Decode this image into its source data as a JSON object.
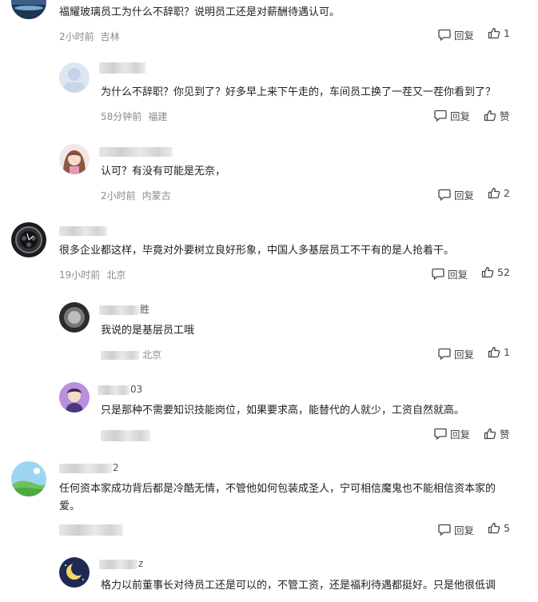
{
  "comments": [
    {
      "text": "福耀玻璃员工为什么不辞职？说明员工还是对薪酬待遇认可。",
      "time": "2小时前",
      "location": "吉林",
      "reply_label": "回复",
      "like_label": "1"
    },
    {
      "username": "",
      "text": "为什么不辞职？你见到了？好多早上来下午走的，车间员工换了一茬又一茬你看到了？",
      "time": "58分钟前",
      "location": "福建",
      "reply_label": "回复",
      "like_label": "赞"
    },
    {
      "username": "",
      "text": "认可？有没有可能是无奈，",
      "time": "2小时前",
      "location": "内蒙古",
      "reply_label": "回复",
      "like_label": "2"
    },
    {
      "username": "",
      "text": "很多企业都这样，毕竟对外要树立良好形象，中国人多基层员工不干有的是人抢着干。",
      "time": "19小时前",
      "location": "北京",
      "reply_label": "回复",
      "like_label": "52"
    },
    {
      "username_suffix": "胜",
      "text": "我说的是基层员工哦",
      "time": "",
      "location": "北京",
      "reply_label": "回复",
      "like_label": "1"
    },
    {
      "username_suffix": "03",
      "text": "只是那种不需要知识技能岗位，如果要求高，能替代的人就少，工资自然就高。",
      "time": "",
      "location": "",
      "reply_label": "回复",
      "like_label": "赞"
    },
    {
      "username_suffix": "2",
      "text_line1": "任何资本家成功背后都是冷酷无情，不管他如何包装成圣人，宁可相信魔鬼也不能相信资本家的",
      "text_line2": "爱。",
      "time": "",
      "location": "",
      "reply_label": "回复",
      "like_label": "5"
    },
    {
      "username_suffix": "z",
      "text": "格力以前董事长对待员工还是可以的，不管工资，还是福利待遇都挺好。只是他很低调"
    }
  ],
  "colors": {
    "meta": "#8a8a8a",
    "text": "#222222",
    "action": "#444444"
  }
}
